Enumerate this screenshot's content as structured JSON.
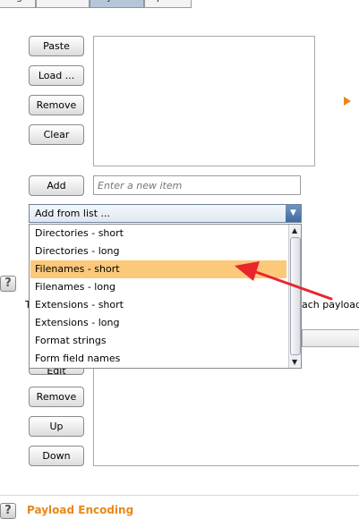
{
  "tabs": [
    {
      "label": "Target"
    },
    {
      "label": "Positions"
    },
    {
      "label": "Payloads"
    },
    {
      "label": "Options"
    }
  ],
  "buttons": {
    "paste": "Paste",
    "load": "Load ...",
    "remove": "Remove",
    "clear": "Clear",
    "add": "Add",
    "edit": "Edit",
    "remove2": "Remove",
    "up": "Up",
    "down": "Down"
  },
  "new_item": {
    "placeholder": "Enter a new item"
  },
  "add_from_list": {
    "label": "Add from list ...",
    "options": [
      "Directories - short",
      "Directories - long",
      "Filenames - short",
      "Filenames - long",
      "Extensions - short",
      "Extensions - long",
      "Format strings",
      "Form field names"
    ],
    "highlighted": "Filenames - short"
  },
  "processing_text_fragment": "ach payload b",
  "section": {
    "payload_encoding": "Payload Encoding"
  },
  "help_label": "?",
  "colors": {
    "highlight": "#fcc87a",
    "annotation_arrow": "#e8262b",
    "section_title": "#e8881a",
    "play_arrow": "#e8881a"
  }
}
